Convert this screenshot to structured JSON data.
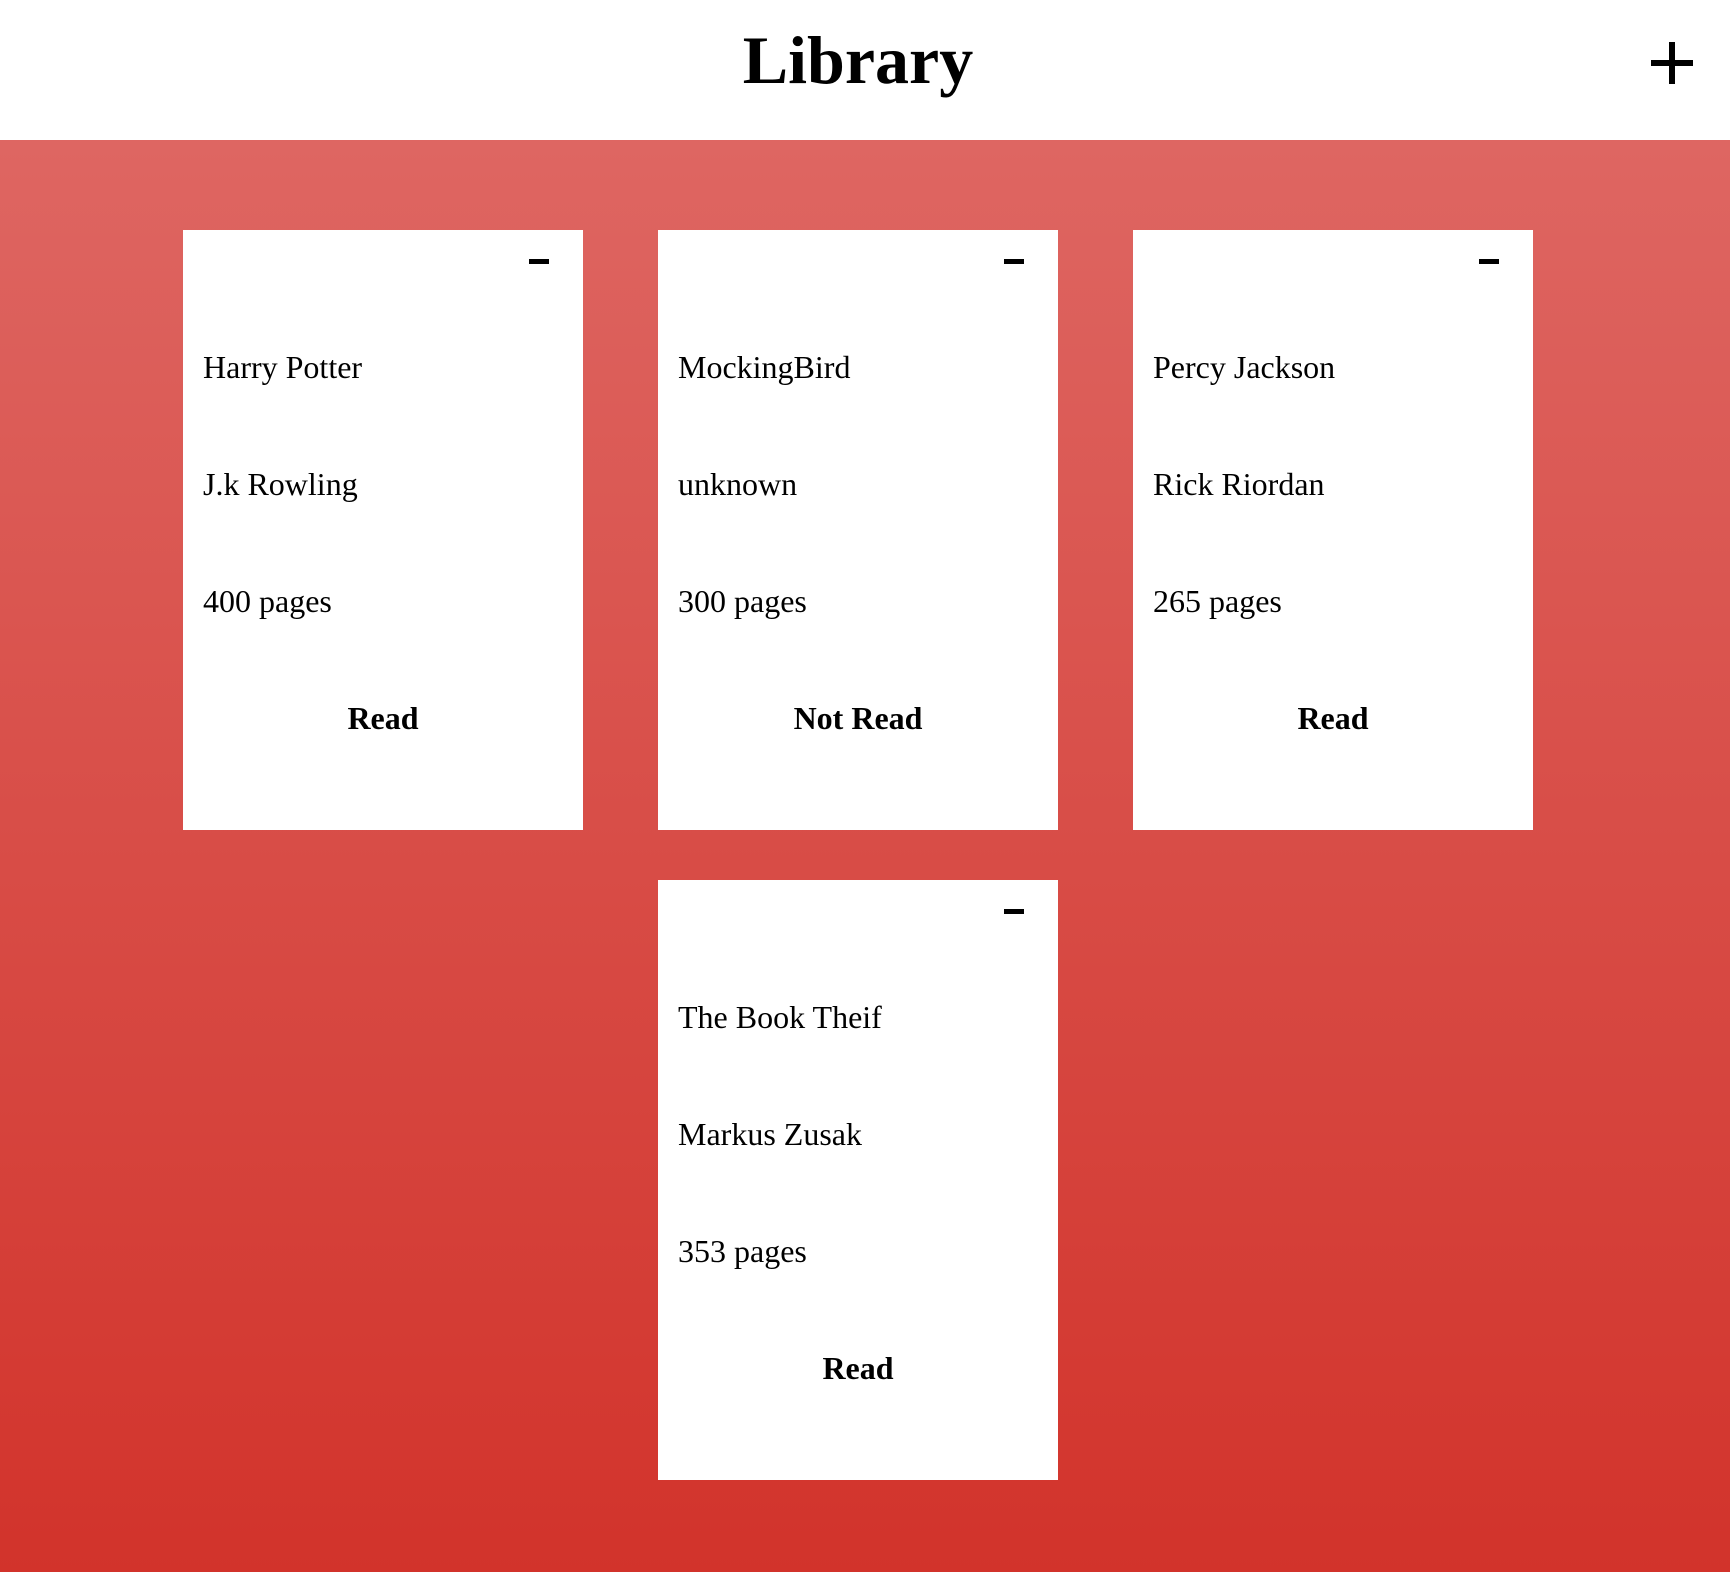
{
  "header": {
    "title": "Library",
    "add_button": "+"
  },
  "books": [
    {
      "title": "Harry Potter",
      "author": "J.k Rowling",
      "pages": "400 pages",
      "status": "Read"
    },
    {
      "title": "MockingBird",
      "author": "unknown",
      "pages": "300 pages",
      "status": "Not Read"
    },
    {
      "title": "Percy Jackson",
      "author": "Rick Riordan",
      "pages": "265 pages",
      "status": "Read"
    },
    {
      "title": "The Book Theif",
      "author": "Markus Zusak",
      "pages": "353 pages",
      "status": "Read"
    }
  ],
  "icons": {
    "add": "plus-icon",
    "remove": "minus-icon"
  },
  "colors": {
    "gradient_top": "#de6662",
    "gradient_bottom": "#d2332b",
    "card": "#ffffff",
    "header": "#ffffff"
  }
}
